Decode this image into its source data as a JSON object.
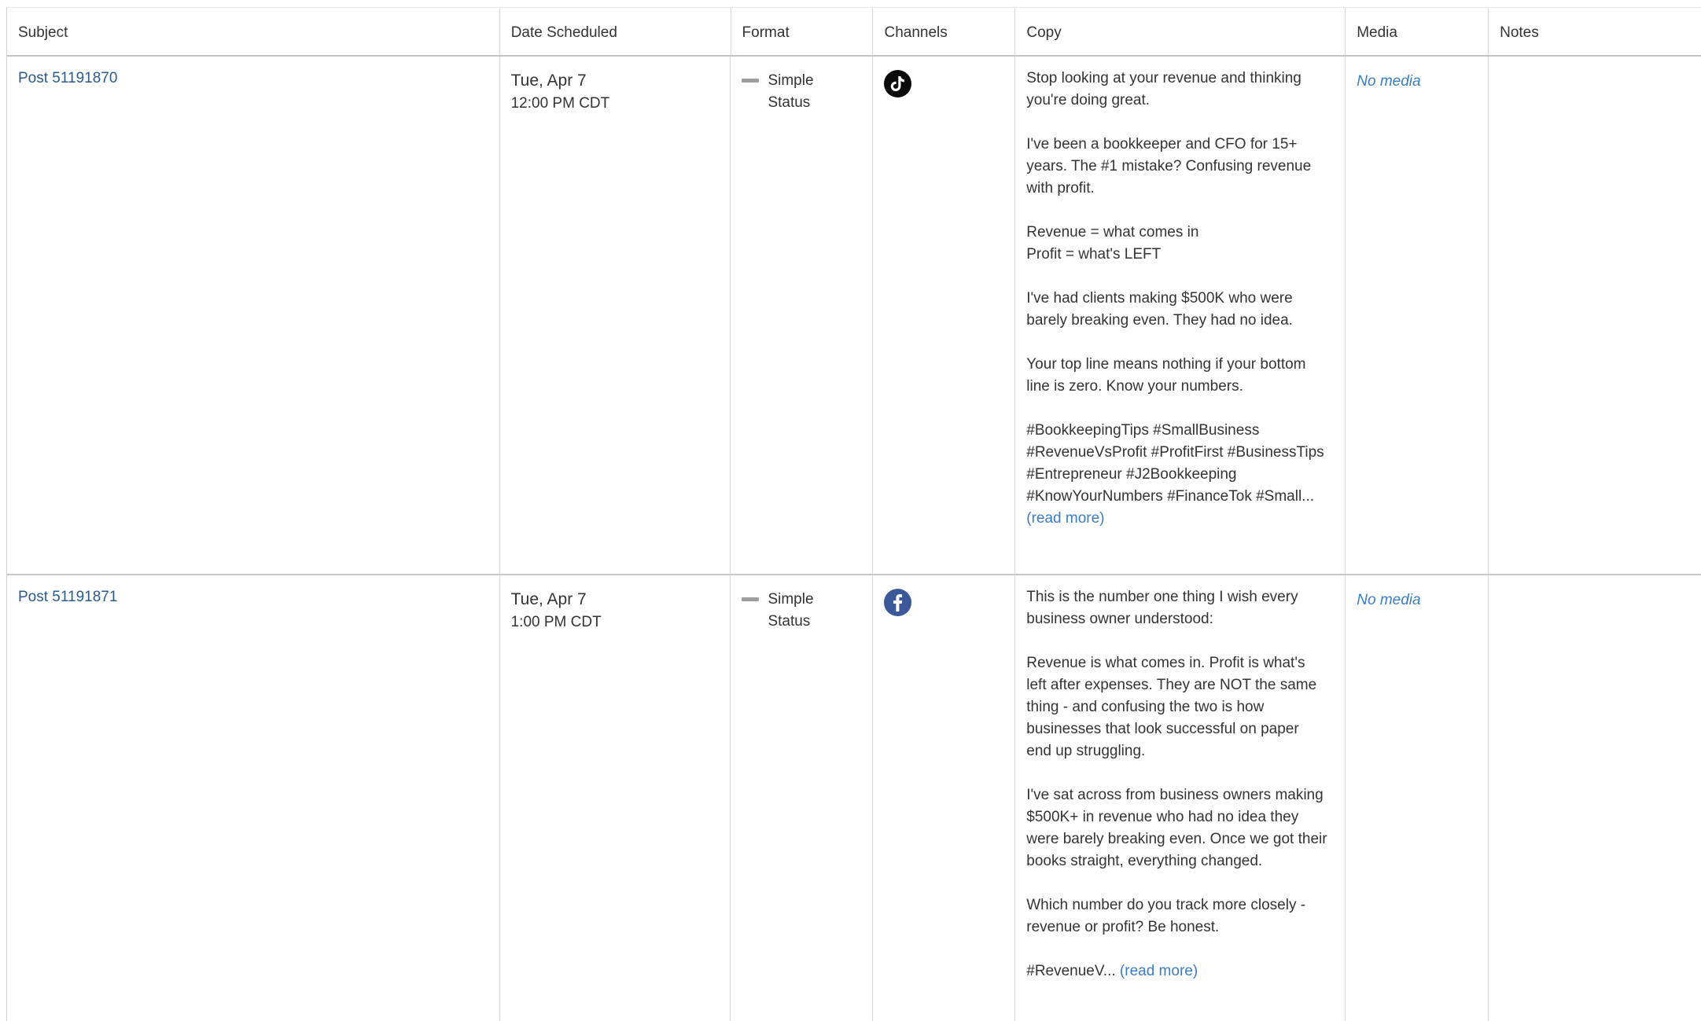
{
  "columns": {
    "subject": "Subject",
    "date": "Date Scheduled",
    "format": "Format",
    "channels": "Channels",
    "copy": "Copy",
    "media": "Media",
    "notes": "Notes"
  },
  "posts": [
    {
      "subject": "Post 51191870",
      "day": "Tue, Apr 7",
      "time": "12:00 PM CDT",
      "format": "Simple Status",
      "channel_icon": "tiktok-icon",
      "copy": [
        "Stop looking at your revenue and thinking\nyou're doing great.",
        "I've been a bookkeeper and CFO for 15+\nyears. The #1 mistake? Confusing revenue\nwith profit.",
        "Revenue = what comes in\nProfit = what's LEFT",
        "I've had clients making $500K who were\nbarely breaking even. They had no idea.",
        "Your top line means nothing if your bottom\nline is zero. Know your numbers.",
        "#BookkeepingTips #SmallBusiness\n#RevenueVsProfit #ProfitFirst #BusinessTips\n#Entrepreneur #J2Bookkeeping\n#KnowYourNumbers #FinanceTok #Small..."
      ],
      "read_more": "(read more)",
      "media": "No media",
      "notes": ""
    },
    {
      "subject": "Post 51191871",
      "day": "Tue, Apr 7",
      "time": "1:00 PM CDT",
      "format": "Simple Status",
      "channel_icon": "facebook-icon",
      "copy": [
        "This is the number one thing I wish every\nbusiness owner understood:",
        "Revenue is what comes in. Profit is what's\nleft after expenses. They are NOT the same\nthing - and confusing the two is how\nbusinesses that look successful on paper\nend up struggling.",
        "I've sat across from business owners making\n$500K+ in revenue who had no idea they\nwere barely breaking even. Once we got their\nbooks straight, everything changed.",
        "Which number do you track more closely -\nrevenue or profit? Be honest.",
        "#RevenueV... "
      ],
      "read_more": "(read more)",
      "media": "No media",
      "notes": ""
    }
  ],
  "colors": {
    "link": "#2b5a8a",
    "accent_link": "#3a7dc0",
    "tiktok": "#0b0b0b",
    "facebook": "#3b5998"
  }
}
